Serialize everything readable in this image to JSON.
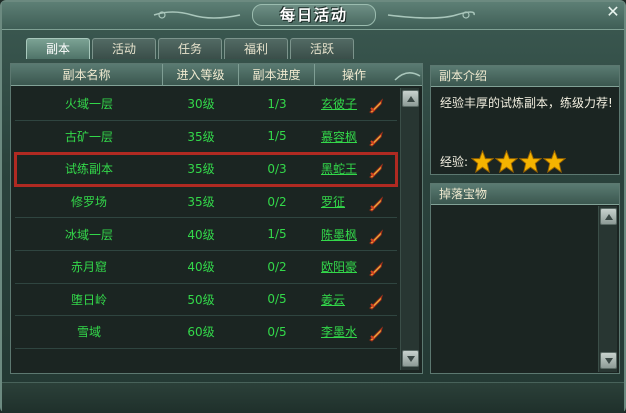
{
  "window": {
    "title": "每日活动",
    "close_glyph": "✕"
  },
  "tabs": [
    {
      "label": "副本",
      "active": true
    },
    {
      "label": "活动",
      "active": false
    },
    {
      "label": "任务",
      "active": false
    },
    {
      "label": "福利",
      "active": false
    },
    {
      "label": "活跃",
      "active": false
    }
  ],
  "table": {
    "headers": {
      "name": "副本名称",
      "level": "进入等级",
      "progress": "副本进度",
      "action": "操作"
    },
    "rows": [
      {
        "name": "火域一层",
        "level": "30级",
        "progress": "1/3",
        "action": "玄彼子",
        "selected": false
      },
      {
        "name": "古矿一层",
        "level": "35级",
        "progress": "1/5",
        "action": "慕容枫",
        "selected": false
      },
      {
        "name": "试练副本",
        "level": "35级",
        "progress": "0/3",
        "action": "黑蛇王",
        "selected": true
      },
      {
        "name": "修罗场",
        "level": "35级",
        "progress": "0/2",
        "action": "罗征",
        "selected": false
      },
      {
        "name": "冰域一层",
        "level": "40级",
        "progress": "1/5",
        "action": "陈墨枫",
        "selected": false
      },
      {
        "name": "赤月窟",
        "level": "40级",
        "progress": "0/2",
        "action": "欧阳豪",
        "selected": false
      },
      {
        "name": "堕日岭",
        "level": "50级",
        "progress": "0/5",
        "action": "姜云",
        "selected": false
      },
      {
        "name": "雪域",
        "level": "60级",
        "progress": "0/5",
        "action": "李墨水",
        "selected": false
      }
    ],
    "row_icon": "sword-icon"
  },
  "info": {
    "header": "副本介绍",
    "description": "经验丰厚的试炼副本，练级力荐!",
    "exp_label": "经验:",
    "exp_stars": 4
  },
  "drops": {
    "header": "掉落宝物"
  },
  "colors": {
    "row_text": "#33d84a",
    "selected_outline": "#b02a22",
    "star": "#f5b400"
  }
}
